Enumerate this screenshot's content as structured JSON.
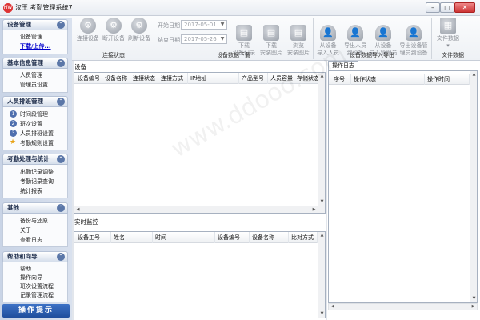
{
  "window": {
    "app_title": "汉王 考勤管理系统7",
    "icon_text": "HW",
    "controls": {
      "min": "–",
      "max": "□",
      "close": "✕"
    }
  },
  "toolbar": {
    "conn": {
      "connect": "连接设备",
      "disconnect": "断开设备",
      "refresh": "刷新设备",
      "group": "连接状态"
    },
    "download": {
      "start_label": "开始日期",
      "start_value": "2017-05-01",
      "end_label": "结束日期",
      "end_value": "2017-05-26",
      "download_records": "下载\n设备记录",
      "download_photos": "下载\n安装图片",
      "browse_photos": "浏览\n安装图片",
      "group": "设备数据下载"
    },
    "io": {
      "import_person": "从设备\n导入人员",
      "export_person": "导出人员\n到设备",
      "import_admin": "从设备\n导入管理员",
      "export_admin": "导出设备管\n理员到设备",
      "group": "设备数据导入导出"
    },
    "file": {
      "file_data": "文件数据",
      "group": "文件数据"
    }
  },
  "sidebar": {
    "sections": [
      {
        "title": "设备管理",
        "items": [
          "设备管理",
          "下载/上传..."
        ]
      },
      {
        "title": "基本信息管理",
        "items": [
          "人员管理",
          "管理员设置"
        ]
      },
      {
        "title": "人员排班管理",
        "items": [
          "时间段管理",
          "班次设置",
          "人员排班设置",
          "考勤规则设置"
        ]
      },
      {
        "title": "考勤处理与统计",
        "items": [
          "出勤记录调整",
          "考勤记录查询",
          "统计报表"
        ]
      },
      {
        "title": "其他",
        "items": [
          "备份与还原",
          "关于",
          "查看日志"
        ]
      },
      {
        "title": "帮助和向导",
        "items": [
          "帮助",
          "操作向导",
          "班次设置流程",
          "记录管理流程"
        ]
      }
    ],
    "footer": "操作提示"
  },
  "device_panel": {
    "title": "设备",
    "columns": [
      "设备编号",
      "设备名称",
      "连接状态",
      "连接方式",
      "IP地址",
      "产品型号",
      "人员容量",
      "存储状态"
    ]
  },
  "monitor_panel": {
    "title": "实时监控",
    "columns": [
      "设备工号",
      "姓名",
      "时间",
      "设备编号",
      "设备名称",
      "比对方式"
    ]
  },
  "log_panel": {
    "tab": "操作日志",
    "columns": [
      "序号",
      "操作状态",
      "操作时间"
    ]
  },
  "watermark": "www.ddooo.com"
}
